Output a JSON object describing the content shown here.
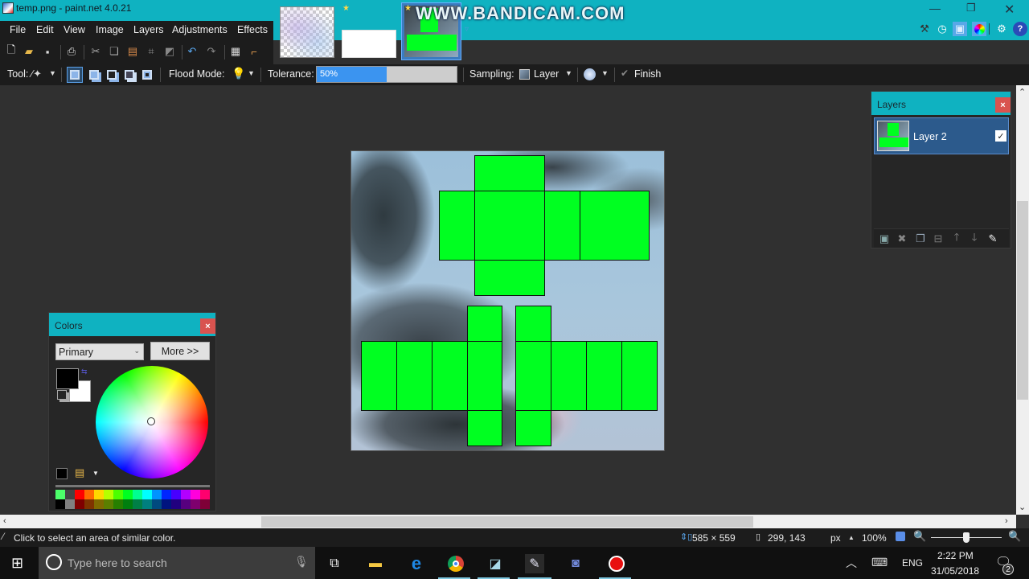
{
  "window": {
    "title": "temp.png - paint.net 4.0.21",
    "minimize_icon": "minimize-icon",
    "restore_icon": "restore-icon",
    "close_icon": "close-icon"
  },
  "watermark": "WWW.BANDICAM.COM",
  "menu": [
    "File",
    "Edit",
    "View",
    "Image",
    "Layers",
    "Adjustments",
    "Effects"
  ],
  "toolbar_icons": [
    "new-icon",
    "open-icon",
    "save-icon",
    "print-icon",
    "cut-icon",
    "copy-icon",
    "paste-icon",
    "crop-icon",
    "deselect-icon",
    "undo-icon",
    "redo-icon",
    "grid-icon",
    "ruler-icon"
  ],
  "image_tabs": [
    {
      "name": "template-checker-thumbnail",
      "starred": false
    },
    {
      "name": "blank-white-thumbnail",
      "starred": true
    },
    {
      "name": "temp-png-thumbnail",
      "starred": true,
      "active": true
    }
  ],
  "right_toolbar_icons": [
    "tools-icon",
    "history-icon",
    "layers-window-icon",
    "colors-window-icon",
    "settings-icon",
    "help-icon"
  ],
  "options": {
    "tool_label": "Tool:",
    "tool_icon": "magic-wand-icon",
    "selection_modes": [
      "replace-mode-icon",
      "union-mode-icon",
      "exclude-mode-icon",
      "intersect-mode-icon",
      "xor-mode-icon"
    ],
    "flood_mode_label": "Flood Mode:",
    "flood_mode_icon": "contiguous-icon",
    "tolerance_label": "Tolerance:",
    "tolerance_value": "50%",
    "tolerance_fraction": 0.5,
    "sampling_label": "Sampling:",
    "sampling_value": "Layer",
    "antialias_icon": "antialiasing-icon",
    "finish_label": "Finish"
  },
  "layers_panel": {
    "title": "Layers",
    "close": "×",
    "layers": [
      {
        "name": "Layer 2",
        "visible": true,
        "check": "✓"
      }
    ],
    "tools": [
      "add-layer-icon",
      "delete-layer-icon",
      "duplicate-layer-icon",
      "merge-layer-down-icon",
      "move-layer-up-icon",
      "move-layer-down-icon",
      "layer-properties-icon"
    ]
  },
  "colors_panel": {
    "title": "Colors",
    "close": "×",
    "mode": "Primary",
    "more_button": "More >>",
    "primary_color": "#000000",
    "secondary_color": "#ffffff",
    "palette_top": [
      "#4cff6a",
      "#444444",
      "#ff0000",
      "#ff6a00",
      "#ffd800",
      "#b6ff00",
      "#4cff00",
      "#00ff21",
      "#00ff90",
      "#00ffff",
      "#0094ff",
      "#0026ff",
      "#4800ff",
      "#b200ff",
      "#ff00dc",
      "#ff006e"
    ],
    "palette_bottom": [
      "#000000",
      "#808080",
      "#7f0000",
      "#7f3300",
      "#7f6a00",
      "#5b7f00",
      "#267f00",
      "#007f0e",
      "#007f46",
      "#007f7f",
      "#004a7f",
      "#00137f",
      "#21007f",
      "#57007f",
      "#7f006e",
      "#7f0037"
    ]
  },
  "status": {
    "hint": "Click to select an area of similar color.",
    "image_size": "585 × 559",
    "cursor_pos": "299, 143",
    "units": "px",
    "zoom": "100%",
    "zoom_slider_fraction": 0.5
  },
  "taskbar": {
    "search_placeholder": "Type here to search",
    "apps": [
      "task-view-icon",
      "file-explorer-icon",
      "edge-icon",
      "chrome-icon",
      "notepad-icon",
      "paint-net-icon",
      "discord-icon",
      "bandicam-record-icon"
    ],
    "tray_language": "ENG",
    "time": "2:22 PM",
    "date": "31/05/2018",
    "notifications": "2"
  },
  "colors": {
    "accent": "#0fb2c1",
    "template_green": "#00ff21",
    "close_red": "#d9534f",
    "selected_layer": "#2c5a8c"
  }
}
